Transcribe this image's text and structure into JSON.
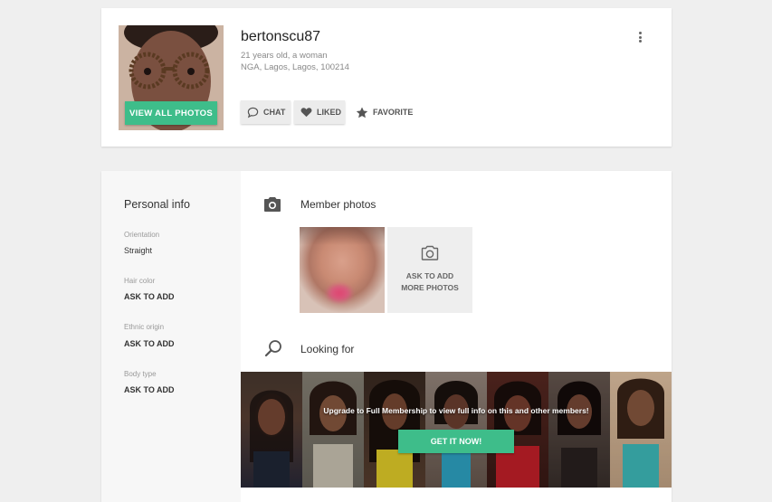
{
  "profile": {
    "username": "bertonscu87",
    "age_gender": "21 years old, a woman",
    "location": "NGA, Lagos, Lagos, 100214",
    "view_photos_label": "VIEW ALL PHOTOS",
    "actions": {
      "chat": "CHAT",
      "liked": "LIKED",
      "favorite": "FAVORITE"
    }
  },
  "personal_info": {
    "title": "Personal info",
    "fields": [
      {
        "label": "Orientation",
        "value": "Straight"
      },
      {
        "label": "Hair color",
        "value": "ASK TO ADD"
      },
      {
        "label": "Ethnic origin",
        "value": "ASK TO ADD"
      },
      {
        "label": "Body type",
        "value": "ASK TO ADD"
      }
    ]
  },
  "member_photos": {
    "title": "Member photos",
    "add_more_label": "ASK TO ADD MORE PHOTOS"
  },
  "looking_for": {
    "title": "Looking for",
    "upgrade_text": "Upgrade to Full Membership to view full info on this and other members!",
    "cta_label": "GET IT NOW!"
  },
  "colors": {
    "accent": "#3ebd8a",
    "background": "#efefef"
  },
  "icons": {
    "chat": "chat-bubble-icon",
    "liked": "heart-icon",
    "favorite": "star-icon",
    "menu": "kebab-menu-icon",
    "photos": "camera-icon",
    "search": "search-icon"
  }
}
